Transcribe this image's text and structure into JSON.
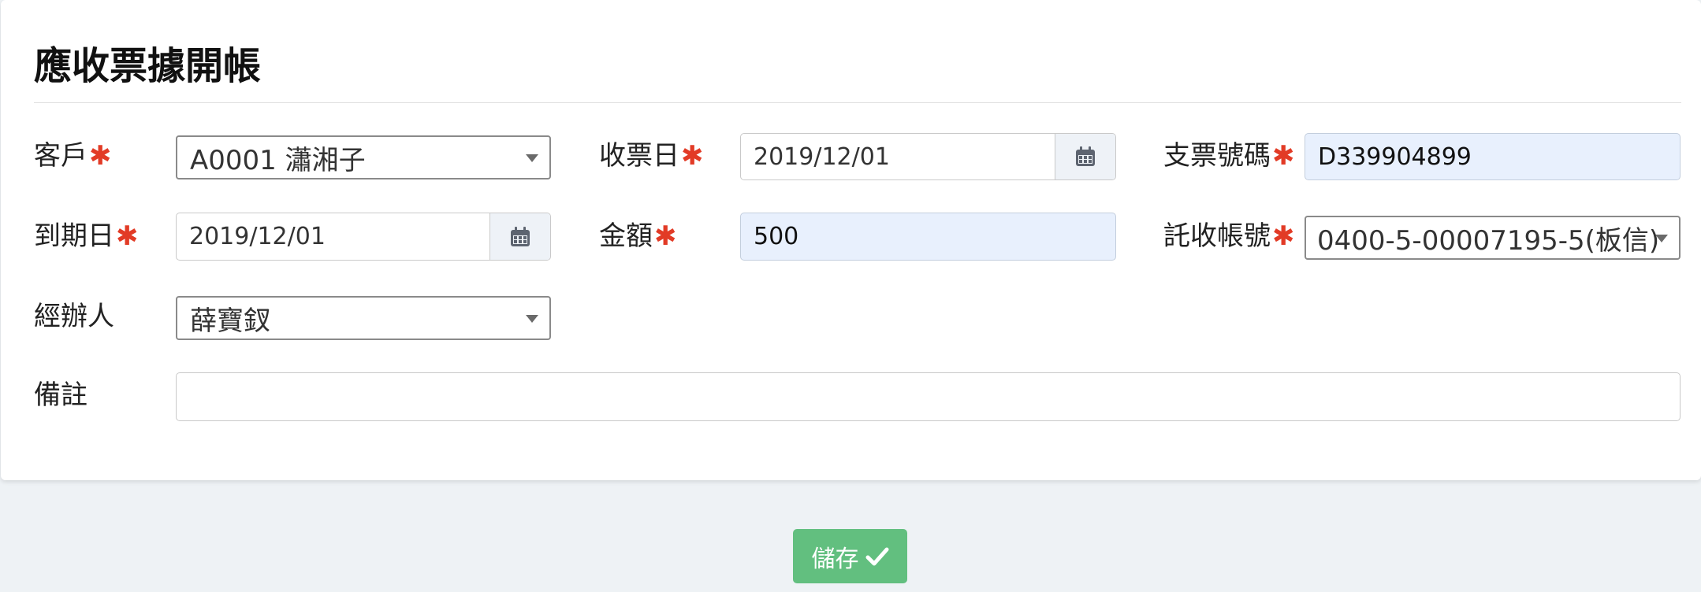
{
  "page": {
    "title": "應收票據開帳"
  },
  "fields": {
    "customer": {
      "label": "客戶",
      "value": "A0001 瀟湘子"
    },
    "receive_date": {
      "label": "收票日",
      "value": "2019/12/01"
    },
    "check_number": {
      "label": "支票號碼",
      "value": "D339904899"
    },
    "due_date": {
      "label": "到期日",
      "value": "2019/12/01"
    },
    "amount": {
      "label": "金額",
      "value": "500"
    },
    "collection_account": {
      "label": "託收帳號",
      "value": "0400-5-00007195-5(板信)"
    },
    "handler": {
      "label": "經辦人",
      "value": "薛寶釵"
    },
    "remarks": {
      "label": "備註",
      "value": ""
    }
  },
  "required_marker": "✱",
  "actions": {
    "save_label": "儲存"
  },
  "icons": {
    "calendar": "calendar-icon",
    "save": "check-icon",
    "dropdown": "chevron-down-icon"
  },
  "colors": {
    "required": "#e23b26",
    "save_button": "#62bf7f",
    "autofill_bg": "#e8f0fd"
  }
}
